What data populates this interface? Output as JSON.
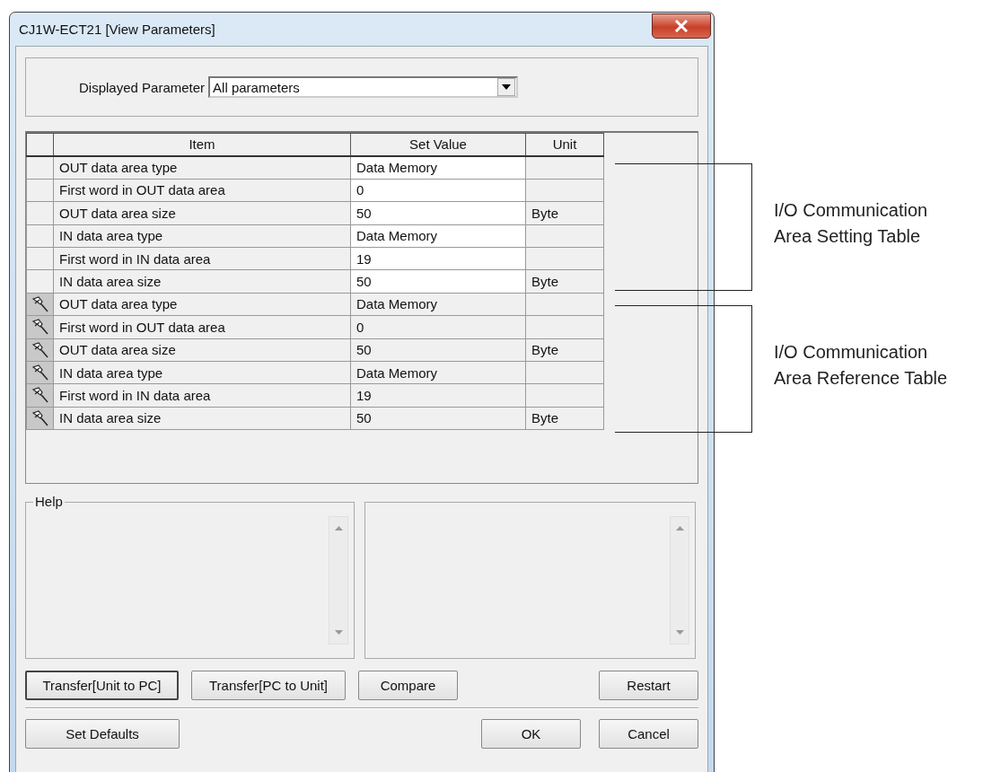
{
  "window": {
    "title": "CJ1W-ECT21 [View Parameters]"
  },
  "displayed_parameter": {
    "label": "Displayed Parameter",
    "value": "All parameters"
  },
  "table": {
    "columns": [
      "Item",
      "Set Value",
      "Unit"
    ],
    "rows": [
      {
        "kind": "setting",
        "item": "OUT data area type",
        "set_value": "Data Memory"
      },
      {
        "kind": "setting",
        "item": "First word in OUT data area",
        "set_value": "0"
      },
      {
        "kind": "setting",
        "item": "OUT data area size",
        "set_value": "50",
        "unit": "Byte"
      },
      {
        "kind": "setting",
        "item": "IN data area type",
        "set_value": "Data Memory"
      },
      {
        "kind": "setting",
        "item": "First word in IN data area",
        "set_value": "19"
      },
      {
        "kind": "setting",
        "item": "IN data area size",
        "set_value": "50",
        "unit": "Byte"
      },
      {
        "kind": "reference",
        "item": "OUT data area type",
        "set_value": "Data Memory"
      },
      {
        "kind": "reference",
        "item": "First word in OUT data area",
        "set_value": "0"
      },
      {
        "kind": "reference",
        "item": "OUT data area size",
        "set_value": "50",
        "unit": "Byte"
      },
      {
        "kind": "reference",
        "item": "IN data area type",
        "set_value": "Data Memory"
      },
      {
        "kind": "reference",
        "item": "First word in IN data area",
        "set_value": "19"
      },
      {
        "kind": "reference",
        "item": "IN data area size",
        "set_value": "50",
        "unit": "Byte"
      }
    ]
  },
  "help": {
    "label": "Help"
  },
  "action_buttons": [
    {
      "label": "Transfer[Unit to PC]",
      "focused": true
    },
    {
      "label": "Transfer[PC to Unit]",
      "focused": false
    },
    {
      "label": "Compare",
      "focused": false
    },
    {
      "label": "Restart",
      "focused": false
    }
  ],
  "footer_buttons": [
    {
      "label": "Set Defaults"
    },
    {
      "label": "OK"
    },
    {
      "label": "Cancel"
    }
  ],
  "callouts": [
    {
      "lines": [
        "I/O Communication",
        "Area Setting Table"
      ]
    },
    {
      "lines": [
        "I/O Communication",
        "Area Reference Table"
      ]
    }
  ]
}
